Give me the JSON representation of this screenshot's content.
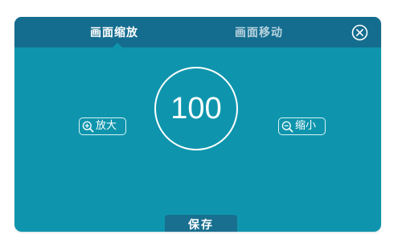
{
  "tabs": {
    "zoom_label": "画面缩放",
    "move_label": "画面移动",
    "active": "zoom"
  },
  "zoom": {
    "value": "100",
    "zoom_in_label": "放大",
    "zoom_out_label": "缩小"
  },
  "actions": {
    "save_label": "保存"
  },
  "icons": {
    "close": "close-circle-icon",
    "zoom_in": "zoom-in-icon",
    "zoom_out": "zoom-out-icon"
  },
  "colors": {
    "header": "#146d8f",
    "body": "#0e95ad",
    "active_tab_text": "#ffffff",
    "inactive_tab_text": "#b9d3df",
    "save_button": "#186f8f"
  }
}
